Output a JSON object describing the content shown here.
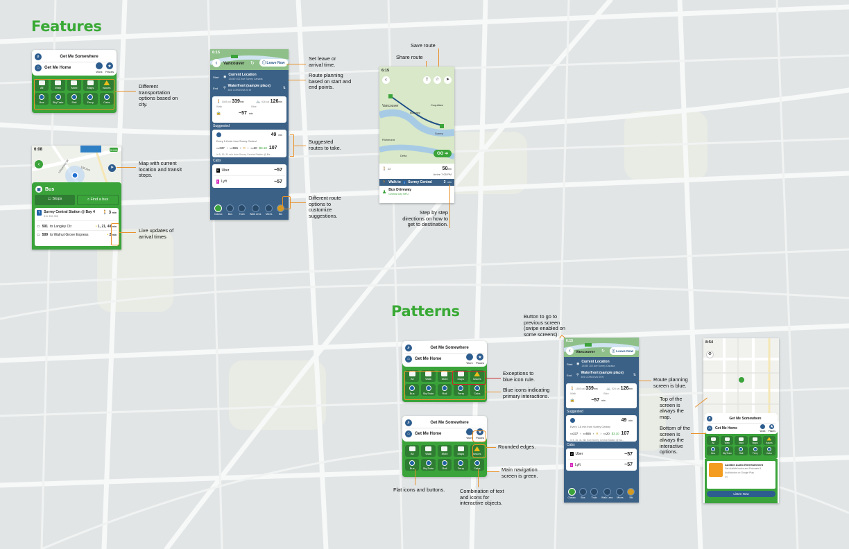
{
  "sections": {
    "features": "Features",
    "patterns": "Patterns"
  },
  "colors": {
    "heading": "#39a935",
    "annotation_line": "#e8912a",
    "exception_box": "#c62828",
    "nav_green": "#3aa33a",
    "planner_blue": "#3b6186"
  },
  "main_card": {
    "search": "Get Me Somewhere",
    "home": "Get Me Home",
    "work": "Work",
    "places": "Places",
    "modes_row1": [
      "All",
      "Walk",
      "Mobi",
      "Maps",
      "Issues"
    ],
    "modes_row2": [
      "Bus",
      "SkyTrain",
      "Rail",
      "Ferry",
      "Cabs"
    ],
    "icons_row1": [
      "bus-icon",
      "walk-icon",
      "bike-icon",
      "map-icon",
      "warning-icon"
    ],
    "icons_row2": [
      "bus-icon",
      "train-icon",
      "rail-icon",
      "ferry-icon",
      "car-icon"
    ]
  },
  "bus_screen": {
    "time": "6:08",
    "title": "Bus",
    "stops_tab": "Stops",
    "find_tab": "Find a bus",
    "station": "Surrey Central Station @ Bay 4",
    "station_sub": "511 356 355",
    "walk_time": "3",
    "walk_unit": "min",
    "routes": [
      {
        "num": "501",
        "dest": "to Langley Ctr",
        "times": "1, 21, 48",
        "unit": "min"
      },
      {
        "num": "509",
        "dest": "to Walnut Grove Express",
        "times": "2",
        "unit": "min"
      }
    ],
    "map_labels": [
      "University Dr",
      "102 Ave",
      "5 MIN"
    ]
  },
  "planner": {
    "time": "6:15",
    "city": "Vancouver",
    "leave_now": "Leave Now",
    "start_label": "Start",
    "start_title": "Current Location",
    "start_sub": "13450 102 Ave Surrey Canada",
    "end_label": "End",
    "end_title": "Waterfront (sample place)",
    "end_sub": "601 CORDOVA St W",
    "walk_val": "339",
    "walk_hint": "1465 cal",
    "walk_unit": "min",
    "walk_label": "Walk",
    "bike_val": "126",
    "bike_hint": "526 cal",
    "bike_unit": "min",
    "bike_label": "Bike",
    "taxi_val": "57",
    "taxi_unit": "min",
    "taxi_label": "Taxi",
    "suggested": "Suggested",
    "sugg_time": "49",
    "sugg_unit": "min",
    "sugg_every": "Every 1-8 min from Surrey Central",
    "sugg_chain": [
      "337",
      "555",
      "R",
      "20",
      "$3.10",
      "107"
    ],
    "sugg_footer": "in 5, 16, 31 min from Surrey Central Station @ Ba...",
    "cabs": "Cabs",
    "cab1": "Uber",
    "cab1_time": "57",
    "cab2": "Lyft",
    "cab2_time": "57",
    "nav": [
      "Classic",
      "Bus",
      "Train",
      "Walk Less",
      "Mixes",
      "Bik"
    ]
  },
  "step_screen": {
    "time": "6:15",
    "map_labels": [
      "Vancouver",
      "Burnaby",
      "Coquitlam",
      "Surrey",
      "Richmond",
      "Delta"
    ],
    "go": "GO",
    "eta_label": "Arrive 7:05 PM",
    "total": "50",
    "total_unit": "min",
    "walk_step": "Walk to",
    "walk_dest": "Surrey Central",
    "walk_step_time": "3",
    "walk_unit": "min",
    "bus_step": "Bus Driveway",
    "bus_sub": "Central City NFU"
  },
  "patterns_map": {
    "time": "8:54",
    "search": "Get Me Somewhere",
    "home": "Get Me Home",
    "work": "Work",
    "places": "Places",
    "modes_row1": [
      "All",
      "Walk",
      "Mobi",
      "Maps",
      "Issues"
    ],
    "modes_row2": [
      "Bus",
      "SkyTrain",
      "Rail",
      "Ferry",
      "Cabs"
    ],
    "ad_title": "Audible Audio Entertainment",
    "ad_body": "Get Audible books and Podcasts & Audiobooks on Google Play",
    "ad_button": "Listen Now",
    "ad_footer": "Ad"
  },
  "annotations": {
    "diff_options": "Different transportation options based on city.",
    "map_current": "Map with current location and transit stops.",
    "live_updates": "Live updates of arrival times",
    "leave_arrival": "Set leave or arrival time.",
    "route_planning": "Route planning based on start and end points.",
    "suggested_routes": "Suggested routes to take.",
    "different_routes": "Different route options to customize suggestions.",
    "save_route": "Save route",
    "share_route": "Share route",
    "step_by_step": "Step by step directions on how to get to destination.",
    "exceptions": "Exceptions to blue icon rule.",
    "blue_icons": "Blue icons indicating primary interactions.",
    "rounded_edges": "Rounded edges.",
    "main_nav_green": "Main navigation screen is green.",
    "flat_icons": "Flat icons and buttons.",
    "combination": "Combination of text and icons for interactive objects.",
    "back_button": "Button to go to previous screen (swipe enabled on some screens).",
    "route_blue": "Route planning screen is blue.",
    "top_map": "Top of the screen is always the map.",
    "bottom_options": "Bottom of the screen is always the interactive options."
  }
}
